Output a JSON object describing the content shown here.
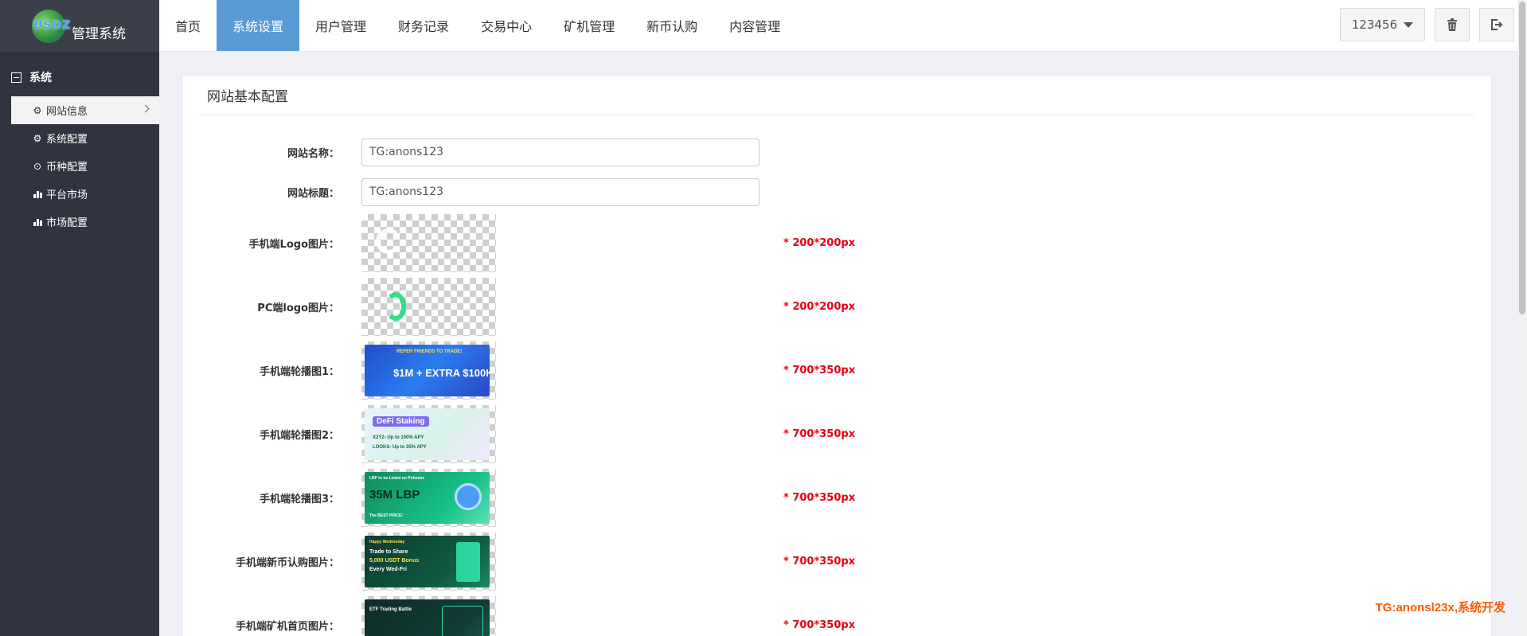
{
  "brand": {
    "mark": "USDZ",
    "title": "管理系统"
  },
  "topnav": {
    "items": [
      {
        "label": "首页",
        "active": false
      },
      {
        "label": "系统设置",
        "active": true
      },
      {
        "label": "用户管理",
        "active": false
      },
      {
        "label": "财务记录",
        "active": false
      },
      {
        "label": "交易中心",
        "active": false
      },
      {
        "label": "矿机管理",
        "active": false
      },
      {
        "label": "新币认购",
        "active": false
      },
      {
        "label": "内容管理",
        "active": false
      }
    ],
    "user": "123456",
    "icons": {
      "trash": "trash-icon",
      "logout": "logout-icon"
    }
  },
  "sidebar": {
    "group": "系统",
    "items": [
      {
        "label": "网站信息",
        "icon": "gear-icon",
        "active": true
      },
      {
        "label": "系统配置",
        "icon": "gear-icon",
        "active": false
      },
      {
        "label": "币种配置",
        "icon": "target-icon",
        "active": false
      },
      {
        "label": "平台市场",
        "icon": "bar-chart-icon",
        "active": false
      },
      {
        "label": "市场配置",
        "icon": "bar-chart-icon",
        "active": false
      }
    ]
  },
  "panel": {
    "title": "网站基本配置",
    "fields": {
      "site_name": {
        "label": "网站名称：",
        "value": "TG:anons123"
      },
      "site_title": {
        "label": "网站标题：",
        "value": "TG:anons123"
      }
    },
    "images": [
      {
        "label": "手机端Logo图片：",
        "hint": "* 200*200px"
      },
      {
        "label": "PC端logo图片：",
        "hint": "* 200*200px"
      },
      {
        "label": "手机端轮播图1：",
        "hint": "* 700*350px",
        "banner": {
          "l1": "REFER FRIENDS TO TRADE!",
          "l2": "$1M + EXTRA $100K"
        }
      },
      {
        "label": "手机端轮播图2：",
        "hint": "* 700*350px",
        "banner": {
          "l1": "DeFi Staking",
          "l2": "X2Y2- Up to 100% APY",
          "l3": "LOOKS- Up to 35% APY"
        }
      },
      {
        "label": "手机端轮播图3：",
        "hint": "* 700*350px",
        "banner": {
          "l1": "LBP to be Listed on Poloniex",
          "l2": "35M LBP",
          "l3": "The BEST PRICE!"
        }
      },
      {
        "label": "手机端新币认购图片：",
        "hint": "* 700*350px",
        "banner": {
          "l1": "Happy Wednesday",
          "l2": "Trade to Share",
          "l3": "5,000 USDT Bonus",
          "l4": "Every Wed-Fri"
        }
      },
      {
        "label": "手机端矿机首页图片：",
        "hint": "* 700*350px",
        "banner": {
          "l1": "ETF Trading Battle"
        }
      }
    ]
  },
  "watermark": "TG:anonsl23x,系统开发",
  "colors": {
    "accent": "#5b9bd5",
    "sidebar": "#2f3440",
    "hint": "#e60012",
    "watermark": "#ff5a00"
  }
}
